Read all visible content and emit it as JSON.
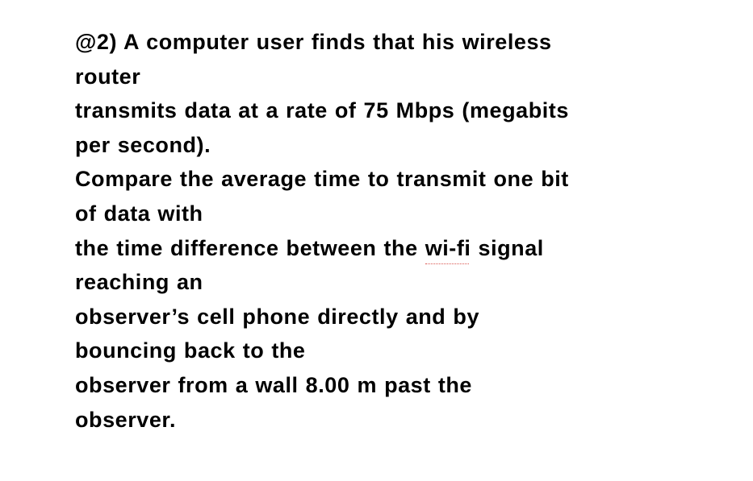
{
  "document": {
    "lines": [
      {
        "text": "@2) A computer user finds that his wireless"
      },
      {
        "text": "router"
      },
      {
        "text": "transmits data at a rate of 75 Mbps (megabits"
      },
      {
        "text": "per second)."
      },
      {
        "text": "Compare the average time to transmit one bit"
      },
      {
        "text": "of data with"
      },
      {
        "before": "the time difference between the ",
        "flagged": "wi-fi",
        "after": " signal"
      },
      {
        "text": "reaching an"
      },
      {
        "text": "observer’s cell phone directly and by"
      },
      {
        "text": "bouncing back to the"
      },
      {
        "text": "observer from a wall 8.00 m past the"
      },
      {
        "text": "observer."
      }
    ],
    "spellcheck_underline_color": "#d9534f"
  }
}
